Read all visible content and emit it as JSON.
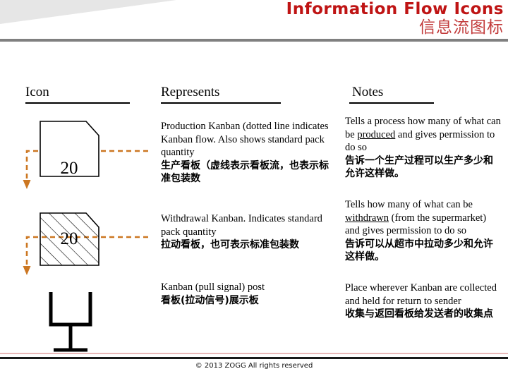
{
  "header": {
    "title_en": "Information Flow Icons",
    "title_zh": "信息流图标",
    "title_color_en": "#bf1414",
    "title_color_zh": "#c23b3b",
    "rule_color": "#808080",
    "wedge_color": "#e6e6e6"
  },
  "table": {
    "columns": [
      {
        "key": "icon",
        "label": "Icon"
      },
      {
        "key": "represents",
        "label": "Represents"
      },
      {
        "key": "notes",
        "label": "Notes"
      }
    ],
    "rows": [
      {
        "icon": {
          "name": "production-kanban-card-icon",
          "quantity_label": "20",
          "fill": "none",
          "stroke": "#000000",
          "flow_line_color": "#cc7722",
          "flow_line_style": "dashed"
        },
        "represents_en": "Production Kanban (dotted line indicates Kanban flow.  Also shows standard pack quantity",
        "represents_zh": "生产看板（虚线表示看板流，也表示标准包装数",
        "notes_en_pre": "Tells a process how many of what can be ",
        "notes_en_underline": "produced",
        "notes_en_post": " and gives permission to do so",
        "notes_zh": "告诉一个生产过程可以生产多少和允许这样做。"
      },
      {
        "icon": {
          "name": "withdrawal-kanban-card-icon",
          "quantity_label": "20",
          "fill": "hatched",
          "stroke": "#000000",
          "flow_line_color": "#cc7722",
          "flow_line_style": "dashed"
        },
        "represents_en": "Withdrawal Kanban.  Indicates standard pack quantity",
        "represents_zh": "拉动看板，也可表示标准包装数",
        "notes_en_pre": "Tells how many of what can be ",
        "notes_en_underline": "withdrawn",
        "notes_en_post": " (from the supermarket) and gives permission to do so",
        "notes_zh": "告诉可以从超市中拉动多少和允许这样做。"
      },
      {
        "icon": {
          "name": "kanban-post-icon",
          "quantity_label": "",
          "fill": "none",
          "stroke": "#000000",
          "flow_line_color": "",
          "flow_line_style": "none"
        },
        "represents_en": "Kanban (pull signal) post",
        "represents_zh": "看板(拉动信号)展示板",
        "notes_en_pre": "Place wherever Kanban are collected and held for return to sender",
        "notes_en_underline": "",
        "notes_en_post": "",
        "notes_zh": "收集与返回看板给发送者的收集点"
      }
    ]
  },
  "footer": {
    "copyright": "© 2013 ZOGG  All rights reserved",
    "rule_pink": "#e8b8b8",
    "rule_black": "#1a1a1a"
  }
}
